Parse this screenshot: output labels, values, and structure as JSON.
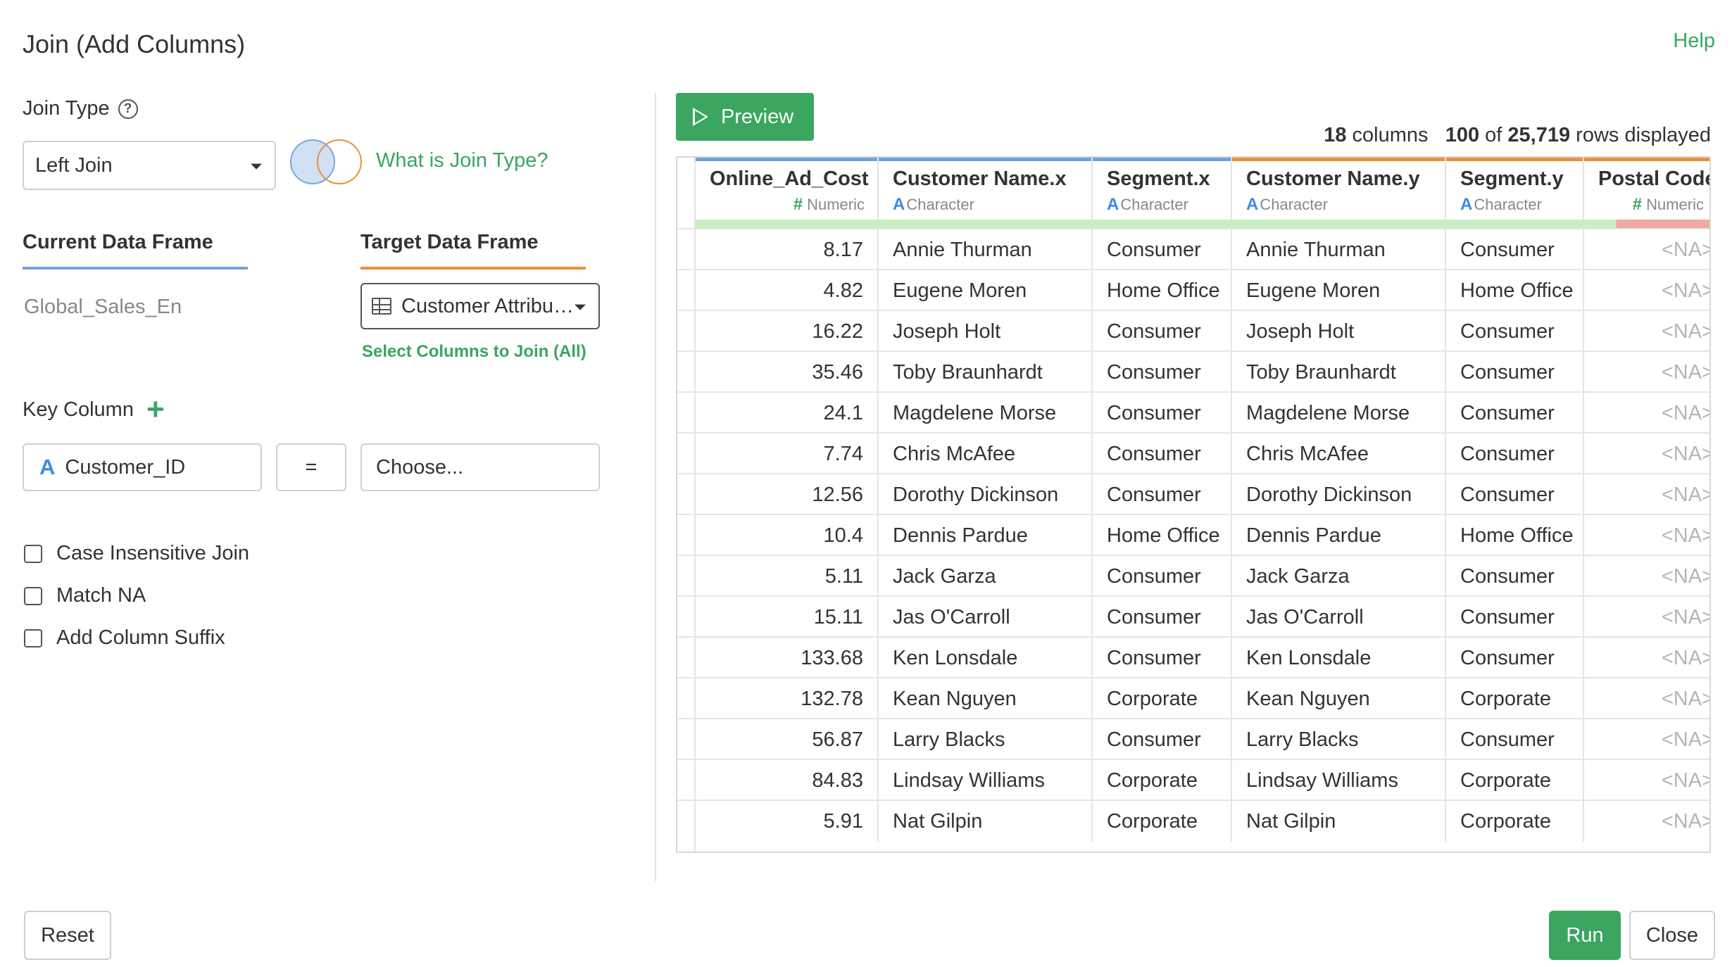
{
  "dialog": {
    "title": "Join (Add Columns)",
    "help": "Help"
  },
  "join_type": {
    "label": "Join Type",
    "help_icon": "question-circle-icon",
    "selected": "Left Join",
    "what_is_link": "What is Join Type?"
  },
  "data_frames": {
    "current_label": "Current Data Frame",
    "current_value": "Global_Sales_En",
    "target_label": "Target Data Frame",
    "target_value": "Customer Attributes",
    "select_columns_link": "Select Columns to Join (All)"
  },
  "key_column": {
    "label": "Key Column",
    "left_type_glyph": "A",
    "left_value": "Customer_ID",
    "operator": "=",
    "right_placeholder": "Choose..."
  },
  "options": [
    {
      "label": "Case Insensitive Join",
      "checked": false
    },
    {
      "label": "Match NA",
      "checked": false
    },
    {
      "label": "Add Column Suffix",
      "checked": false
    }
  ],
  "preview": {
    "button_label": "Preview",
    "stats": {
      "columns": "18",
      "columns_word": "columns",
      "shown": "100",
      "of_word": "of",
      "total": "25,719",
      "rows_word": "rows displayed"
    }
  },
  "table": {
    "columns": [
      {
        "name": "Online_Ad_Cost",
        "type_glyph": "#",
        "type": "Numeric",
        "align": "right"
      },
      {
        "name": "Customer Name.x",
        "type_glyph": "A",
        "type": "Character",
        "align": "left"
      },
      {
        "name": "Segment.x",
        "type_glyph": "A",
        "type": "Character",
        "align": "left"
      },
      {
        "name": "Customer Name.y",
        "type_glyph": "A",
        "type": "Character",
        "align": "left"
      },
      {
        "name": "Segment.y",
        "type_glyph": "A",
        "type": "Character",
        "align": "left"
      },
      {
        "name": "Postal Code",
        "type_glyph": "#",
        "type": "Numeric",
        "align": "right"
      }
    ],
    "rows": [
      [
        "8.17",
        "Annie Thurman",
        "Consumer",
        "Annie Thurman",
        "Consumer",
        "<NA>"
      ],
      [
        "4.82",
        "Eugene Moren",
        "Home Office",
        "Eugene Moren",
        "Home Office",
        "<NA>"
      ],
      [
        "16.22",
        "Joseph Holt",
        "Consumer",
        "Joseph Holt",
        "Consumer",
        "<NA>"
      ],
      [
        "35.46",
        "Toby Braunhardt",
        "Consumer",
        "Toby Braunhardt",
        "Consumer",
        "<NA>"
      ],
      [
        "24.1",
        "Magdelene Morse",
        "Consumer",
        "Magdelene Morse",
        "Consumer",
        "<NA>"
      ],
      [
        "7.74",
        "Chris McAfee",
        "Consumer",
        "Chris McAfee",
        "Consumer",
        "<NA>"
      ],
      [
        "12.56",
        "Dorothy Dickinson",
        "Consumer",
        "Dorothy Dickinson",
        "Consumer",
        "<NA>"
      ],
      [
        "10.4",
        "Dennis Pardue",
        "Home Office",
        "Dennis Pardue",
        "Home Office",
        "<NA>"
      ],
      [
        "5.11",
        "Jack Garza",
        "Consumer",
        "Jack Garza",
        "Consumer",
        "<NA>"
      ],
      [
        "15.11",
        "Jas O'Carroll",
        "Consumer",
        "Jas O'Carroll",
        "Consumer",
        "<NA>"
      ],
      [
        "133.68",
        "Ken Lonsdale",
        "Consumer",
        "Ken Lonsdale",
        "Consumer",
        "<NA>"
      ],
      [
        "132.78",
        "Kean Nguyen",
        "Corporate",
        "Kean Nguyen",
        "Corporate",
        "<NA>"
      ],
      [
        "56.87",
        "Larry Blacks",
        "Consumer",
        "Larry Blacks",
        "Consumer",
        "<NA>"
      ],
      [
        "84.83",
        "Lindsay Williams",
        "Corporate",
        "Lindsay Williams",
        "Corporate",
        "<NA>"
      ],
      [
        "5.91",
        "Nat Gilpin",
        "Corporate",
        "Nat Gilpin",
        "Corporate",
        "<NA>"
      ]
    ]
  },
  "footer": {
    "reset": "Reset",
    "run": "Run",
    "close": "Close"
  },
  "colors": {
    "accent_green": "#3aa65f",
    "current_blue": "#6fa3dd",
    "target_orange": "#e8903a",
    "quality_ok": "#c7efc0",
    "quality_na": "#f0a9a0"
  }
}
